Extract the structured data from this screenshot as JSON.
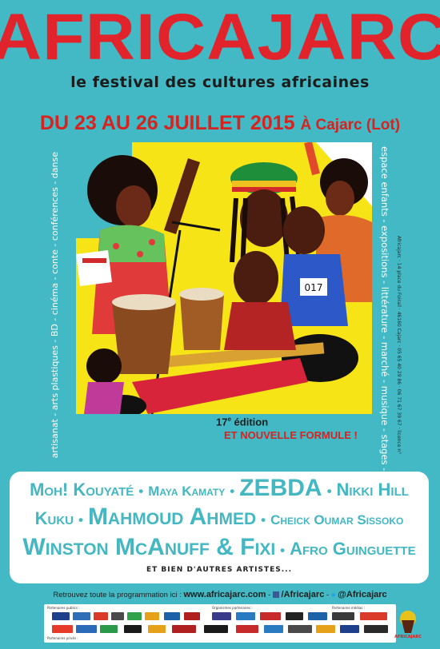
{
  "header": {
    "title": "AFRICAJARC",
    "subtitle": "le festival des cultures africaines",
    "dates": "DU 23 AU 26 JUILLET 2015",
    "place": "À Cajarc (Lot)"
  },
  "sidebars": {
    "left": "artisanat - arts plastiques - BD - cinéma - conte - conférences - danse",
    "right": "espace enfants - expositions - littérature - marché - musique - stages - théâtre",
    "contact": "Africajarc · 14 place du Foirail · 46160 Cajarc · 05 65 40 29 86 · 06 71 67 39 67 · licence n°"
  },
  "edition": {
    "number": "17",
    "suffix": "e",
    "label": "édition",
    "formula": "ET NOUVELLE FORMULE !"
  },
  "artists": {
    "line1": [
      "Moh! Kouyaté",
      "Maya Kamaty",
      "Zebda",
      "Nikki Hill"
    ],
    "line2": [
      "Kuku",
      "Mahmoud Ahmed",
      "Cheick Oumar Sissoko"
    ],
    "line3": [
      "Winston McAnuff & Fixi",
      "Afro Guinguette"
    ],
    "others": "ET BIEN D'AUTRES ARTISTES..."
  },
  "footer": {
    "prefix": "Retrouvez toute la programmation ici :",
    "website": "www.africajarc.com",
    "separator1": " - ",
    "facebook": "/Africajarc",
    "separator2": " - ",
    "twitter": "@Africajarc",
    "partners_public": "Partenaires publics :",
    "partners_private": "Partenaires privés :",
    "organisers": "Organismes partenaires :",
    "media": "Partenaires médias :",
    "logo_label": "AFRICAJARC"
  },
  "colors": {
    "background": "#42b9c4",
    "title": "#e1242b",
    "artist_text": "#43b7c2",
    "artwork_yellow": "#f6e417"
  }
}
